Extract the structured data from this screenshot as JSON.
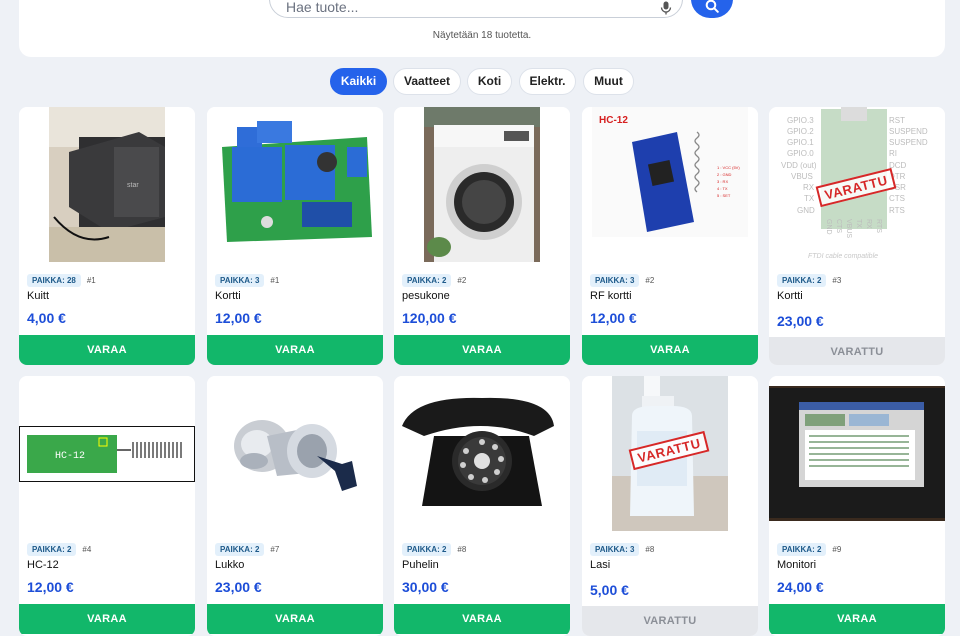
{
  "search": {
    "placeholder": "Hae tuote...",
    "result_count": "Näytetään 18 tuotetta."
  },
  "filters": [
    "Kaikki",
    "Vaatteet",
    "Koti",
    "Elektr.",
    "Muut"
  ],
  "active_filter": "Kaikki",
  "colors": {
    "accent": "#2563eb",
    "reserve_button": "#12b76a",
    "price": "#1d4ed8",
    "reserved_stamp": "#d62828"
  },
  "products": [
    {
      "badge": "PAIKKA: 28",
      "index": "#1",
      "name": "Kuitt",
      "price": "4,00 €",
      "button": "VARAA",
      "reserved": false,
      "image": "receipt-printer"
    },
    {
      "badge": "PAIKKA: 3",
      "index": "#1",
      "name": "Kortti",
      "price": "12,00 €",
      "button": "VARAA",
      "reserved": false,
      "image": "relay-board"
    },
    {
      "badge": "PAIKKA: 2",
      "index": "#2",
      "name": "pesukone",
      "price": "120,00 €",
      "button": "VARAA",
      "reserved": false,
      "image": "washing-machine"
    },
    {
      "badge": "PAIKKA: 3",
      "index": "#2",
      "name": "RF kortti",
      "price": "12,00 €",
      "button": "VARAA",
      "reserved": false,
      "image": "hc12-module",
      "image_text": {
        "title": "HC-12",
        "pins": [
          "1 : VCC (5V)",
          "2 : GND",
          "3 : RX",
          "4 : TX",
          "5 : SET"
        ]
      }
    },
    {
      "badge": "PAIKKA: 2",
      "index": "#3",
      "name": "Kortti",
      "price": "23,00 €",
      "button": "VARATTU",
      "reserved": true,
      "stamp": "VARATTU",
      "image": "ftdi-board",
      "image_text": {
        "left_pins": [
          "GPIO.3",
          "GPIO.2",
          "GPIO.1",
          "GPIO.0",
          "VDD (out)",
          "VBUS",
          "RX",
          "TX",
          "GND"
        ],
        "right_pins": [
          "RST",
          "SUSPEND",
          "SUSPEND",
          "RI",
          "DCD",
          "DTR",
          "DSR",
          "CTS",
          "RTS"
        ],
        "bottom_pins": [
          "GND",
          "CTS",
          "VBUS",
          "TX",
          "RX",
          "RTS"
        ],
        "caption": "FTDI cable compatible"
      }
    },
    {
      "badge": "PAIKKA: 2",
      "index": "#4",
      "name": "HC-12",
      "price": "12,00 €",
      "button": "VARAA",
      "reserved": false,
      "image": "hc12-diagram",
      "image_text": {
        "label": "HC-12"
      }
    },
    {
      "badge": "PAIKKA: 2",
      "index": "#7",
      "name": "Lukko",
      "price": "23,00 €",
      "button": "VARAA",
      "reserved": false,
      "image": "lock-cylinder"
    },
    {
      "badge": "PAIKKA: 2",
      "index": "#8",
      "name": "Puhelin",
      "price": "30,00 €",
      "button": "VARAA",
      "reserved": false,
      "image": "rotary-phone"
    },
    {
      "badge": "PAIKKA: 3",
      "index": "#8",
      "name": "Lasi",
      "price": "5,00 €",
      "button": "VARATTU",
      "reserved": true,
      "stamp": "VARATTU",
      "image": "spray-bottle"
    },
    {
      "badge": "PAIKKA: 2",
      "index": "#9",
      "name": "Monitori",
      "price": "24,00 €",
      "button": "VARAA",
      "reserved": false,
      "image": "monitor"
    }
  ]
}
